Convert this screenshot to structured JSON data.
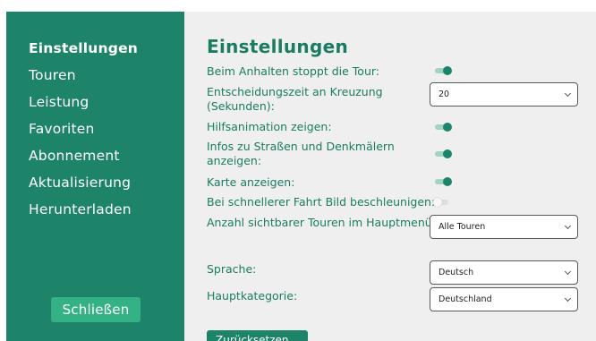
{
  "sidebar": {
    "items": [
      {
        "label": "Einstellungen",
        "active": true
      },
      {
        "label": "Touren"
      },
      {
        "label": "Leistung"
      },
      {
        "label": "Favoriten"
      },
      {
        "label": "Abonnement"
      },
      {
        "label": "Aktualisierung"
      },
      {
        "label": "Herunterladen"
      }
    ],
    "close_label": "Schließen"
  },
  "main": {
    "title": "Einstellungen",
    "settings": {
      "stop_tour": {
        "label": "Beim Anhalten stoppt die Tour:",
        "on": true
      },
      "decision_time": {
        "label": "Entscheidungszeit an Kreuzung (Sekunden):",
        "value": "20"
      },
      "help_animation": {
        "label": "Hilfsanimation zeigen:",
        "on": true
      },
      "street_info": {
        "label": "Infos zu Straßen und Denkmälern anzeigen:",
        "on": true
      },
      "show_map": {
        "label": "Karte anzeigen:",
        "on": true
      },
      "speed_up": {
        "label": "Bei schnellerer Fahrt Bild beschleunigen:",
        "on": false
      },
      "visible_tours": {
        "label": "Anzahl sichtbarer Touren im Hauptmenü:",
        "value": "Alle Touren"
      },
      "language": {
        "label": "Sprache:",
        "value": "Deutsch"
      },
      "main_category": {
        "label": "Hauptkategorie:",
        "value": "Deutschland"
      }
    },
    "back_label": "Zurücksetzen"
  },
  "colors": {
    "accent": "#1e8469",
    "close_button": "#35b285",
    "panel_background": "#efefef"
  }
}
